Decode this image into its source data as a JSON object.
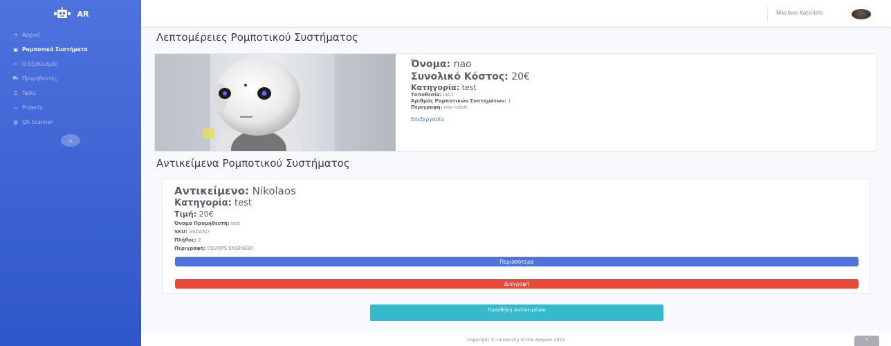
{
  "sidebar": {
    "brand": "AR",
    "items": [
      {
        "label": "Αρχική",
        "icon": "dashboard-icon"
      },
      {
        "label": "Ρομποτικά Συστήματα",
        "icon": "robot-icon"
      },
      {
        "label": "Ο Εξοπλισμός",
        "icon": "tools-icon"
      },
      {
        "label": "Προμηθευτές",
        "icon": "cart-icon"
      },
      {
        "label": "Tasks",
        "icon": "list-icon"
      },
      {
        "label": "Projects",
        "icon": "folder-icon"
      },
      {
        "label": "QR Scanner",
        "icon": "qr-icon"
      }
    ],
    "toggle": "<"
  },
  "topbar": {
    "user": "Nikolaos Katsilidis"
  },
  "details": {
    "title": "Λεπτομέρειες Ρομποτικού Συστήματος",
    "name_label": "Όνομα:",
    "name": "nao",
    "cost_label": "Συνολικό Κόστος:",
    "cost": "20€",
    "category_label": "Κατηγορία:",
    "category": "test",
    "location_label": "Τοποθεσία:",
    "location": "lab1",
    "count_label": "Αριθμός Ρομποτικών Συστημάτων:",
    "count": "1",
    "desc_label": "Περιγραφή:",
    "desc": "nao robot",
    "edit": "Επεξεργασία"
  },
  "items": {
    "title": "Αντικείμενα Ρομποτικού Συστήματος",
    "item_label": "Αντικείμενο:",
    "item": "Nikolaos",
    "category_label": "Κατηγορία:",
    "category": "test",
    "price_label": "Τιμή:",
    "price": "20€",
    "supplier_label": "Όνομα Προμηθευτή:",
    "supplier": "test",
    "sku_label": "SKU:",
    "sku": "ASDASD",
    "qty_label": "Πλήθος:",
    "qty": "2",
    "desc_label": "Περιγραφή:",
    "desc": "DEVOPS ENGINEER",
    "more": "Περισσότερα",
    "delete": "Διαγραφή",
    "add": "Προσθήκη Αντικειμένου"
  },
  "footer": "Copyright © University of the Aegean 2019",
  "scroll_top": "^"
}
